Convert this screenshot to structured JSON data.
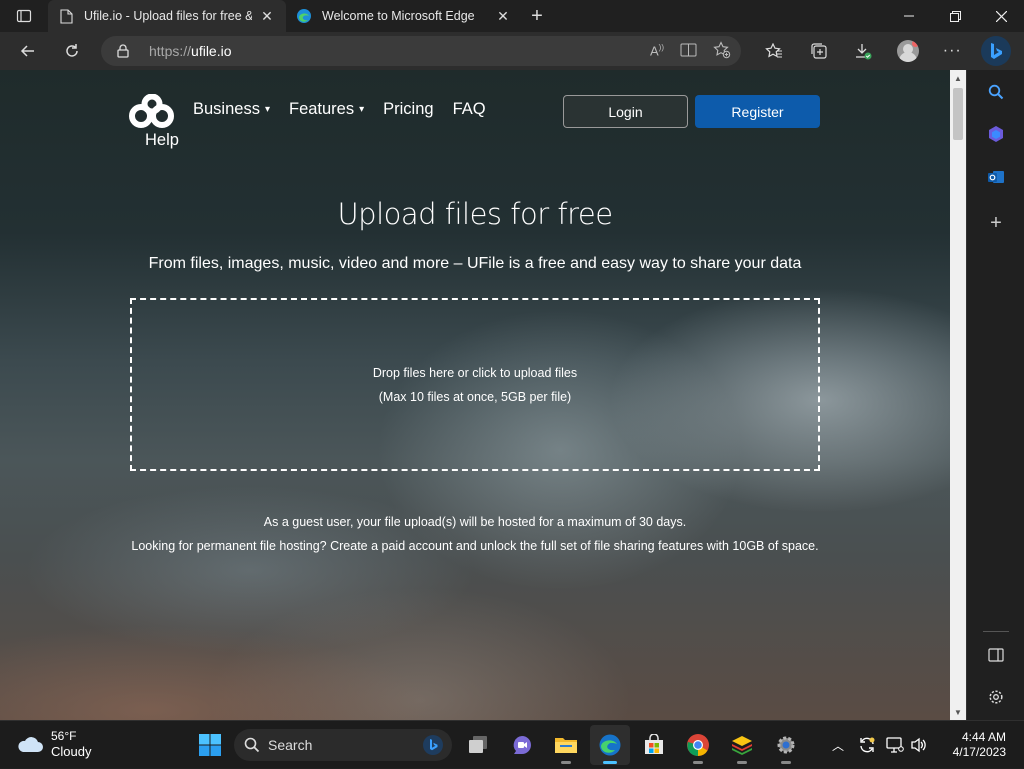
{
  "browser": {
    "tabs": [
      {
        "title": "Ufile.io - Upload files for free & s",
        "active": true,
        "icon": "page-icon"
      },
      {
        "title": "Welcome to Microsoft Edge",
        "active": false,
        "icon": "edge-icon"
      }
    ],
    "address": {
      "scheme": "https://",
      "host": "ufile.io"
    }
  },
  "site": {
    "nav": {
      "business": "Business",
      "features": "Features",
      "pricing": "Pricing",
      "faq": "FAQ",
      "help": "Help"
    },
    "login_label": "Login",
    "register_label": "Register",
    "hero_title": "Upload files for free",
    "hero_subtitle": "From files, images, music, video and more – UFile is a free and easy way to share your data",
    "dropzone": {
      "line1": "Drop files here or click to upload files",
      "line2": "(Max 10 files at once, 5GB per file)"
    },
    "guest_note": {
      "line1": "As a guest user, your file upload(s) will be hosted for a maximum of 30 days.",
      "line2": "Looking for permanent file hosting? Create a paid account and unlock the full set of file sharing features with 10GB of space."
    }
  },
  "taskbar": {
    "weather_temp": "56°F",
    "weather_desc": "Cloudy",
    "search_label": "Search",
    "time": "4:44 AM",
    "date": "4/17/2023"
  },
  "colors": {
    "register_blue": "#0d5bab",
    "accent": "#4cc2ff"
  }
}
